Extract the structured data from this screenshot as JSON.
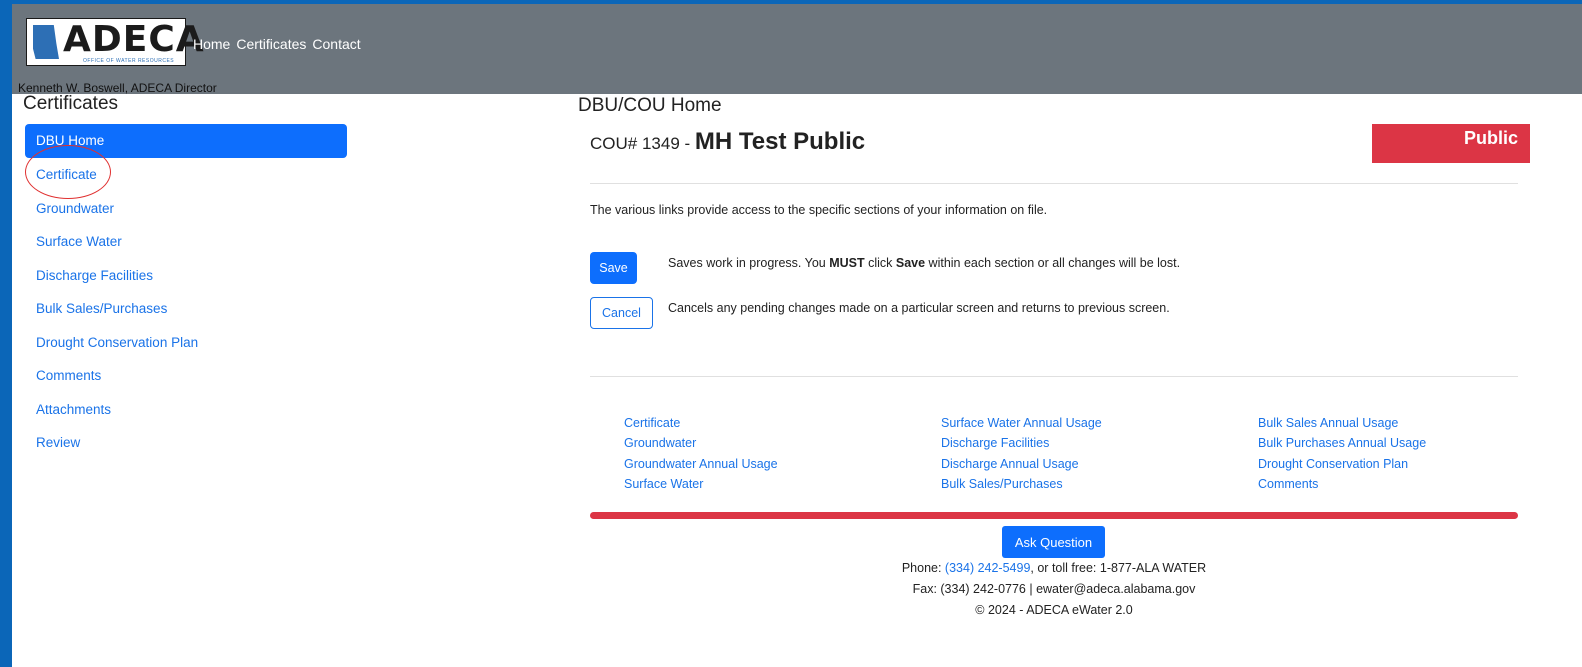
{
  "header": {
    "logo_text": "ADECA",
    "logo_subtext": "OFFICE OF WATER RESOURCES",
    "nav": [
      "Home",
      "Certificates",
      "Contact"
    ],
    "director": "Kenneth W. Boswell, ADECA Director"
  },
  "sidebar": {
    "title": "Certificates",
    "items": [
      {
        "label": "DBU Home",
        "active": true
      },
      {
        "label": "Certificate"
      },
      {
        "label": "Groundwater"
      },
      {
        "label": "Surface Water"
      },
      {
        "label": "Discharge Facilities"
      },
      {
        "label": "Bulk Sales/Purchases"
      },
      {
        "label": "Drought Conservation Plan"
      },
      {
        "label": "Comments"
      },
      {
        "label": "Attachments"
      },
      {
        "label": "Review"
      }
    ],
    "annotation": "red circle around Certificate"
  },
  "main": {
    "title": "DBU/COU Home",
    "cou_number": "COU# 1349 - ",
    "cou_name": "MH Test Public",
    "badge": "Public",
    "intro": "The various links provide access to the specific sections of your information on file.",
    "save_label": "Save",
    "save_desc_a": "Saves work in progress. You ",
    "save_desc_b": "MUST",
    "save_desc_c": " click ",
    "save_desc_d": "Save",
    "save_desc_e": " within each section or all changes will be lost.",
    "cancel_label": "Cancel",
    "cancel_desc": "Cancels any pending changes made on a particular screen and returns to previous screen.",
    "links": [
      [
        "Certificate",
        "Groundwater",
        "Groundwater Annual Usage",
        "Surface Water"
      ],
      [
        "Surface Water Annual Usage",
        "Discharge Facilities",
        "Discharge Annual Usage",
        "Bulk Sales/Purchases"
      ],
      [
        "Bulk Sales Annual Usage",
        "Bulk Purchases Annual Usage",
        "Drought Conservation Plan",
        "Comments"
      ]
    ]
  },
  "footer": {
    "ask_label": "Ask Question",
    "phone_prefix": "Phone: ",
    "phone": "(334) 242-5499",
    "phone_suffix": ", or toll free: 1-877-ALA WATER",
    "fax_line": "Fax: (334) 242-0776 | ewater@adeca.alabama.gov",
    "copyright": "© 2024 - ADECA eWater 2.0"
  },
  "colors": {
    "page_border": "#0b66b8",
    "topbar": "#6c757d",
    "primary": "#0d6efd",
    "link": "#1a73e8",
    "danger": "#dc3545",
    "annotation": "#e03030"
  }
}
